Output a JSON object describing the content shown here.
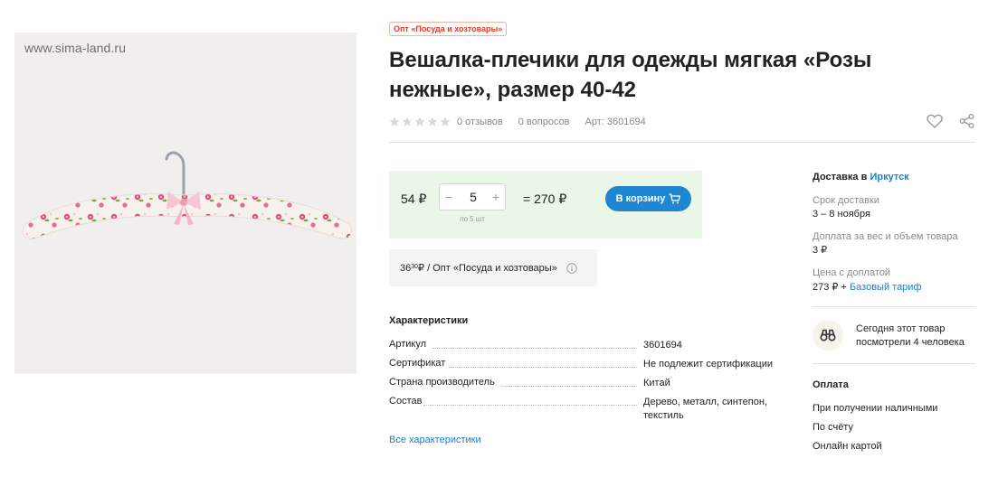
{
  "image": {
    "watermark": "www.sima-land.ru"
  },
  "product": {
    "badge": "Опт «Посуда и хозтовары»",
    "title": "Вешалка-плечики для одежды мягкая «Розы нежные», размер 40-42",
    "rating_stars": 0,
    "reviews": "0 отзывов",
    "questions": "0 вопросов",
    "article": "Арт: 3601694"
  },
  "price": {
    "unit_price": "54 ₽",
    "minus": "−",
    "plus": "+",
    "quantity": "5",
    "step_hint": "по 5 шт",
    "total": "= 270 ₽",
    "cart_button": "В корзину"
  },
  "wholesale": {
    "price_main": "36",
    "price_cents": "30",
    "text": " ₽ / Опт «Посуда и хозтовары»"
  },
  "characteristics": {
    "title": "Характеристики",
    "rows": [
      {
        "key": "Артикул",
        "value": "3601694"
      },
      {
        "key": "Сертификат",
        "value": "Не подлежит сертификации"
      },
      {
        "key": "Страна производитель",
        "value": "Китай"
      },
      {
        "key": "Состав",
        "value": "Дерево, металл, синтепон, текстиль"
      }
    ],
    "all_link": "Все характеристики"
  },
  "delivery": {
    "label": "Доставка в ",
    "city": "Иркутск",
    "term_label": "Срок доставки",
    "term_value": "3 – 8 ноября",
    "extra_label": "Доплата за вес и объем товара",
    "extra_value": "3 ₽",
    "price_label": "Цена с доплатой",
    "price_value": "273 ₽ + ",
    "tariff_link": "Базовый тариф"
  },
  "views": {
    "text": "Сегодня этот товар посмотрели 4 человека"
  },
  "payment": {
    "title": "Оплата",
    "methods": [
      "При получении наличными",
      "По счёту",
      "Онлайн картой"
    ]
  },
  "colors": {
    "accent": "#1f86d1",
    "link": "#1f7dc8",
    "badge": "#e53a26",
    "price_bg": "#eaf6e8"
  }
}
